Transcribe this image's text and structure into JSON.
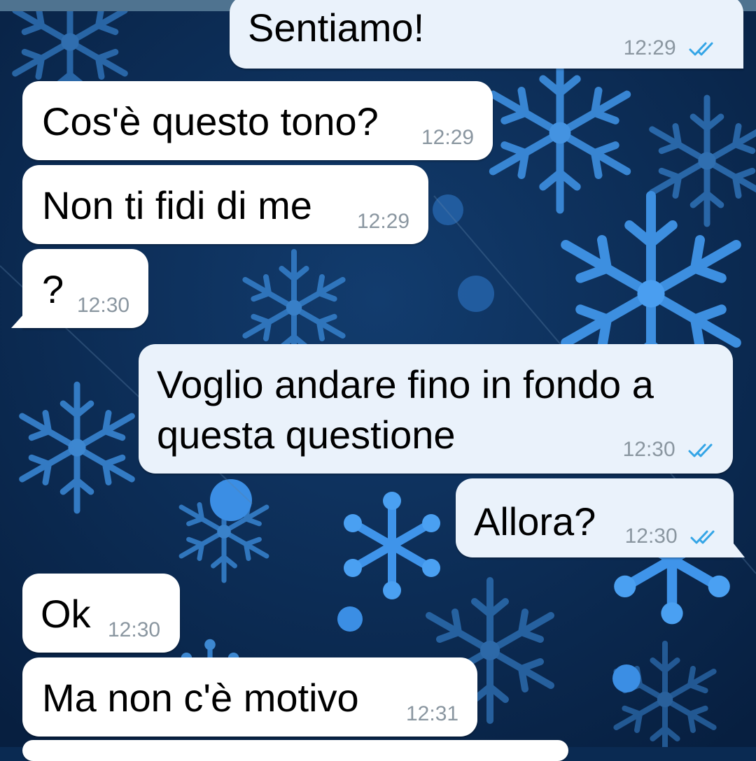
{
  "accent_colors": {
    "incoming_bubble": "#ffffff",
    "outgoing_bubble": "#eaf2fb",
    "timestamp": "#8a96a0",
    "read_ticks": "#34a5e6"
  },
  "messages": [
    {
      "direction": "out",
      "text": "Sentiamo!",
      "time": "12:29",
      "status": "read-double-check-icon"
    },
    {
      "direction": "in",
      "text": "Cos'è questo tono?",
      "time": "12:29"
    },
    {
      "direction": "in",
      "text": "Non ti fidi di me",
      "time": "12:29"
    },
    {
      "direction": "in",
      "text": "?",
      "time": "12:30"
    },
    {
      "direction": "out",
      "text_line1": "Voglio andare fino in fondo a",
      "text_line2": "questa questione",
      "time": "12:30",
      "status": "read-double-check-icon"
    },
    {
      "direction": "out",
      "text": "Allora?",
      "time": "12:30",
      "status": "read-double-check-icon"
    },
    {
      "direction": "in",
      "text": "Ok",
      "time": "12:30"
    },
    {
      "direction": "in",
      "text": "Ma non c'è motivo",
      "time": "12:31"
    }
  ]
}
